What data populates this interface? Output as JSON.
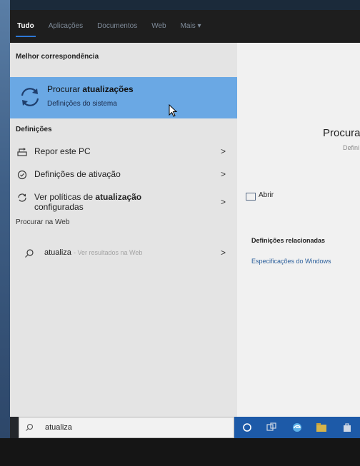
{
  "nav": {
    "tabs": [
      "Tudo",
      "Aplicações",
      "Documentos",
      "Web",
      "Mais ▾"
    ]
  },
  "best_match": {
    "header": "Melhor correspondência",
    "title_prefix": "Procurar ",
    "title_bold": "atualizações",
    "subtitle": "Definições do sistema",
    "icon": "refresh-icon"
  },
  "settings": {
    "header": "Definições",
    "items": [
      {
        "label": "Repor este PC",
        "icon": "reset-pc-icon",
        "arrow": ">"
      },
      {
        "label": "Definições de ativação",
        "icon": "check-circle-icon",
        "arrow": ">"
      },
      {
        "label_prefix": "Ver políticas de ",
        "label_bold": "atualização",
        "label_line2": "configuradas",
        "icon": "refresh-icon",
        "arrow": ">"
      }
    ]
  },
  "web": {
    "header": "Procurar na Web",
    "query": "atualiza",
    "hint": "- Ver resultados na Web",
    "arrow": ">"
  },
  "preview": {
    "title": "Procura",
    "subtitle": "Defini",
    "open_label": "Abrir",
    "related_header": "Definições relacionadas",
    "related_link": "Especificações do Windows"
  },
  "taskbar": {
    "search_value": "atualiza"
  },
  "colors": {
    "accent": "#2d78d6",
    "highlight": "#6aa8e4",
    "nav_bg": "#1e1e1e",
    "taskbar_blue": "#1d5aa8"
  }
}
